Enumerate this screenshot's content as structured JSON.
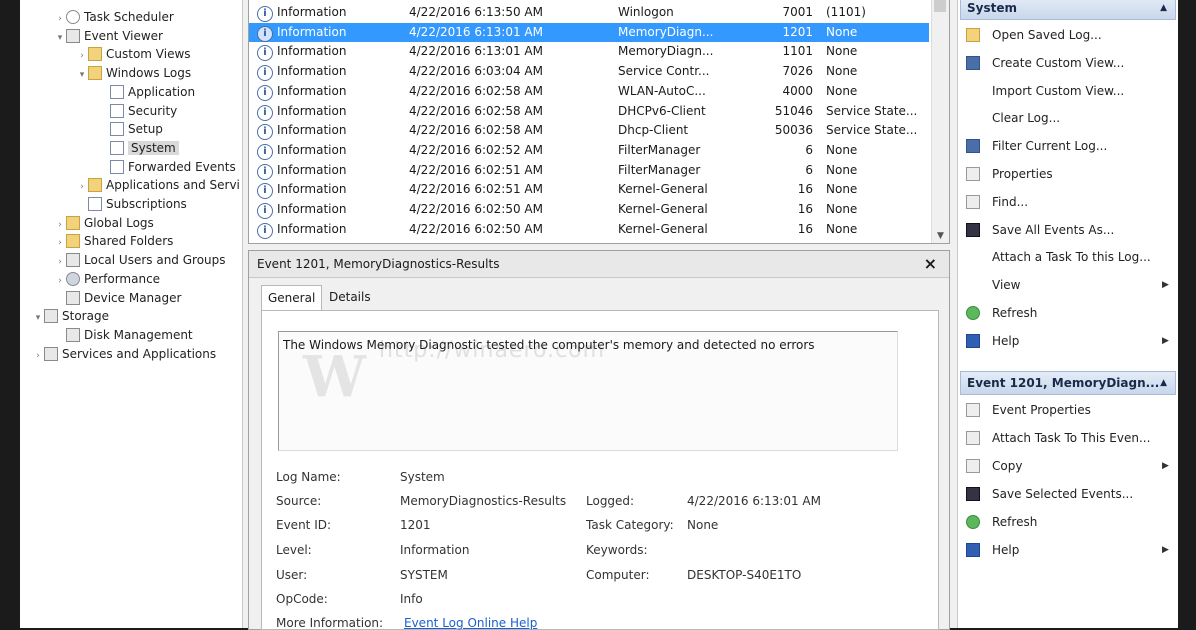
{
  "tree": {
    "items": [
      {
        "label": "Task Scheduler",
        "indent": 1,
        "arrow": ">",
        "icon": "clock-icon"
      },
      {
        "label": "Event Viewer",
        "indent": 1,
        "arrow": "v",
        "icon": "event-viewer-icon"
      },
      {
        "label": "Custom Views",
        "indent": 2,
        "arrow": ">",
        "icon": "folder-icon"
      },
      {
        "label": "Windows Logs",
        "indent": 2,
        "arrow": "v",
        "icon": "folder-icon"
      },
      {
        "label": "Application",
        "indent": 3,
        "arrow": "",
        "icon": "log-icon"
      },
      {
        "label": "Security",
        "indent": 3,
        "arrow": "",
        "icon": "log-icon"
      },
      {
        "label": "Setup",
        "indent": 3,
        "arrow": "",
        "icon": "log-icon"
      },
      {
        "label": "System",
        "indent": 3,
        "arrow": "",
        "icon": "log-icon",
        "selected": true
      },
      {
        "label": "Forwarded Events",
        "indent": 3,
        "arrow": "",
        "icon": "log-icon"
      },
      {
        "label": "Applications and Servi",
        "indent": 2,
        "arrow": ">",
        "icon": "folder-icon"
      },
      {
        "label": "Subscriptions",
        "indent": 2,
        "arrow": "",
        "icon": "log-icon"
      },
      {
        "label": "Global Logs",
        "indent": 1,
        "arrow": ">",
        "icon": "folder-icon"
      },
      {
        "label": "Shared Folders",
        "indent": 1,
        "arrow": ">",
        "icon": "folder-icon"
      },
      {
        "label": "Local Users and Groups",
        "indent": 1,
        "arrow": ">",
        "icon": "users-icon"
      },
      {
        "label": "Performance",
        "indent": 1,
        "arrow": ">",
        "icon": "performance-icon"
      },
      {
        "label": "Device Manager",
        "indent": 1,
        "arrow": "",
        "icon": "device-manager-icon"
      },
      {
        "label": "Storage",
        "indent": 0,
        "arrow": "v",
        "icon": "storage-icon"
      },
      {
        "label": "Disk Management",
        "indent": 1,
        "arrow": "",
        "icon": "disk-icon"
      },
      {
        "label": "Services and Applications",
        "indent": 0,
        "arrow": ">",
        "icon": "services-icon"
      }
    ]
  },
  "events": {
    "rows": [
      {
        "level": "Information",
        "date": "4/22/2016 6:13:50 AM",
        "source": "Winlogon",
        "id": "7001",
        "category": "(1101)"
      },
      {
        "level": "Information",
        "date": "4/22/2016 6:13:01 AM",
        "source": "MemoryDiagn...",
        "id": "1201",
        "category": "None",
        "selected": true
      },
      {
        "level": "Information",
        "date": "4/22/2016 6:13:01 AM",
        "source": "MemoryDiagn...",
        "id": "1101",
        "category": "None"
      },
      {
        "level": "Information",
        "date": "4/22/2016 6:03:04 AM",
        "source": "Service Contr...",
        "id": "7026",
        "category": "None"
      },
      {
        "level": "Information",
        "date": "4/22/2016 6:02:58 AM",
        "source": "WLAN-AutoC...",
        "id": "4000",
        "category": "None"
      },
      {
        "level": "Information",
        "date": "4/22/2016 6:02:58 AM",
        "source": "DHCPv6-Client",
        "id": "51046",
        "category": "Service State..."
      },
      {
        "level": "Information",
        "date": "4/22/2016 6:02:58 AM",
        "source": "Dhcp-Client",
        "id": "50036",
        "category": "Service State..."
      },
      {
        "level": "Information",
        "date": "4/22/2016 6:02:52 AM",
        "source": "FilterManager",
        "id": "6",
        "category": "None"
      },
      {
        "level": "Information",
        "date": "4/22/2016 6:02:51 AM",
        "source": "FilterManager",
        "id": "6",
        "category": "None"
      },
      {
        "level": "Information",
        "date": "4/22/2016 6:02:51 AM",
        "source": "Kernel-General",
        "id": "16",
        "category": "None"
      },
      {
        "level": "Information",
        "date": "4/22/2016 6:02:50 AM",
        "source": "Kernel-General",
        "id": "16",
        "category": "None"
      },
      {
        "level": "Information",
        "date": "4/22/2016 6:02:50 AM",
        "source": "Kernel-General",
        "id": "16",
        "category": "None"
      }
    ]
  },
  "detail": {
    "title": "Event 1201, MemoryDiagnostics-Results",
    "close": "×",
    "tabs": {
      "general": "General",
      "details": "Details"
    },
    "description": "The Windows Memory Diagnostic tested the computer's memory and detected no errors",
    "watermark": {
      "letter": "W",
      "url": "http://winaero.com"
    },
    "fields": {
      "log_name_label": "Log Name:",
      "log_name": "System",
      "source_label": "Source:",
      "source": "MemoryDiagnostics-Results",
      "logged_label": "Logged:",
      "logged": "4/22/2016 6:13:01 AM",
      "event_id_label": "Event ID:",
      "event_id": "1201",
      "task_category_label": "Task Category:",
      "task_category": "None",
      "level_label": "Level:",
      "level": "Information",
      "keywords_label": "Keywords:",
      "user_label": "User:",
      "user": "SYSTEM",
      "computer_label": "Computer:",
      "computer": "DESKTOP-S40E1TO",
      "opcode_label": "OpCode:",
      "opcode": "Info",
      "more_info_label": "More Information:",
      "more_info_link": "Event Log Online Help"
    }
  },
  "actions": {
    "system_header": "System",
    "system_items": [
      {
        "label": "Open Saved Log...",
        "icon": "open-folder-icon"
      },
      {
        "label": "Create Custom View...",
        "icon": "funnel-icon"
      },
      {
        "label": "Import Custom View...",
        "icon": ""
      },
      {
        "label": "Clear Log...",
        "icon": ""
      },
      {
        "label": "Filter Current Log...",
        "icon": "funnel-icon"
      },
      {
        "label": "Properties",
        "icon": "properties-icon"
      },
      {
        "label": "Find...",
        "icon": "binoculars-icon"
      },
      {
        "label": "Save All Events As...",
        "icon": "save-icon"
      },
      {
        "label": "Attach a Task To this Log...",
        "icon": ""
      },
      {
        "label": "View",
        "icon": "",
        "submenu": true
      },
      {
        "label": "Refresh",
        "icon": "refresh-icon"
      },
      {
        "label": "Help",
        "icon": "help-icon",
        "submenu": true
      }
    ],
    "event_header": "Event 1201, MemoryDiagn...",
    "event_items": [
      {
        "label": "Event Properties",
        "icon": "properties-icon"
      },
      {
        "label": "Attach Task To This Even...",
        "icon": "task-icon"
      },
      {
        "label": "Copy",
        "icon": "copy-icon",
        "submenu": true
      },
      {
        "label": "Save Selected Events...",
        "icon": "save-icon"
      },
      {
        "label": "Refresh",
        "icon": "refresh-icon"
      },
      {
        "label": "Help",
        "icon": "help-icon",
        "submenu": true
      }
    ]
  }
}
